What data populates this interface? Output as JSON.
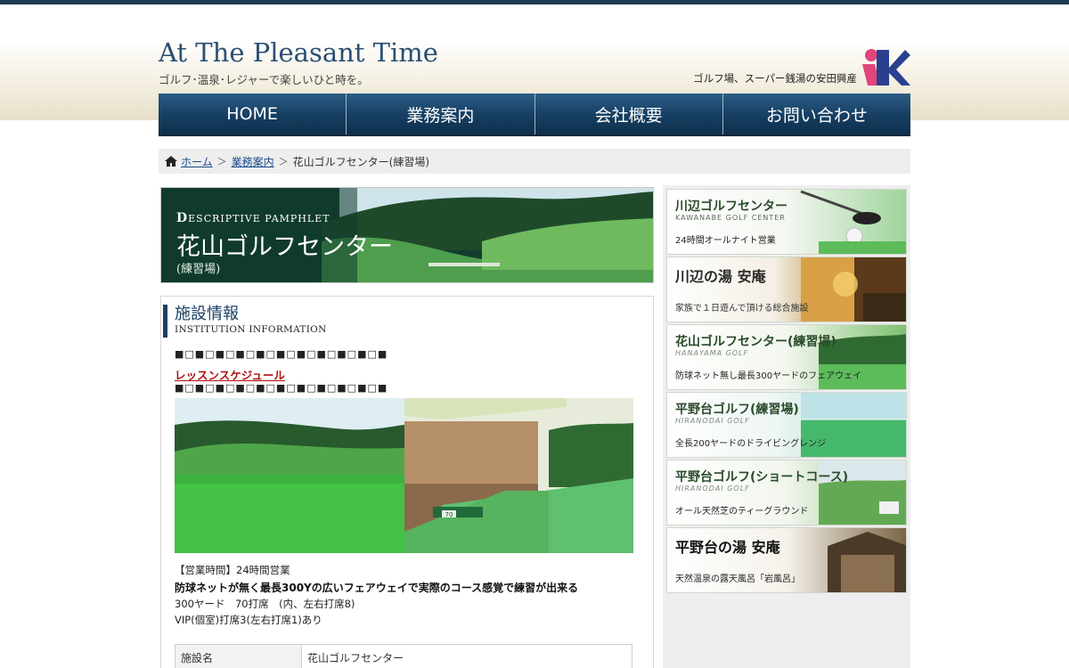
{
  "header": {
    "title": "At The Pleasant Time",
    "tagline": "ゴルフ･温泉･レジャーで楽しいひと時を。",
    "company": "ゴルフ場、スーパー銭湯の安田興産",
    "logo_text": "YK"
  },
  "nav": [
    {
      "label": "HOME"
    },
    {
      "label": "業務案内"
    },
    {
      "label": "会社概要"
    },
    {
      "label": "お問い合わせ"
    }
  ],
  "breadcrumb": {
    "home": "ホーム",
    "sep": "＞",
    "parent": "業務案内",
    "current": "花山ゴルフセンター(練習場)"
  },
  "hero": {
    "pamphlet_initial": "D",
    "pamphlet_rest": "ESCRIPTIVE PAMPHLET",
    "title": "花山ゴルフセンター",
    "subtitle": "(練習場)"
  },
  "info": {
    "title": "施設情報",
    "title_en": "INSTITUTION INFORMATION",
    "squares": "■□■□■□■□■□■□■□■□■□■□■",
    "lesson_link": "レッスンスケジュール",
    "hours": "【営業時間】24時間営業",
    "headline": "防球ネットが無く最長300Yの広いフェアウェイで実際のコース感覚で練習が出来る",
    "detail1": "300ヤード　70打席　(内、左右打席8)",
    "detail2": "VIP(個室)打席3(左右打席1)あり",
    "bay_number": "70",
    "table": [
      {
        "label": "施設名",
        "value": "花山ゴルフセンター"
      }
    ]
  },
  "sidebar": [
    {
      "title": "川辺ゴルフセンター",
      "en": "KAWANABE GOLF CENTER",
      "desc": "24時間オールナイト営業",
      "theme": "light",
      "title_color": "#2b4b2b"
    },
    {
      "title": "川辺の湯 安庵",
      "en": "",
      "desc": "家族で１日遊んで頂ける総合施設",
      "theme": "dark",
      "title_color": "#ffffff"
    },
    {
      "title": "花山ゴルフセンター(練習場)",
      "en": "HANAYAMA GOLF",
      "desc": "防球ネット無し最長300ヤードのフェアウェイ",
      "theme": "light",
      "title_color": "#2b4b2b"
    },
    {
      "title": "平野台ゴルフ(練習場)",
      "en": "HIRANODAI GOLF",
      "desc": "全長200ヤードのドライビングレンジ",
      "theme": "light",
      "title_color": "#2b4b2b"
    },
    {
      "title": "平野台ゴルフ(ショートコース)",
      "en": "HIRANODAI GOLF",
      "desc": "オール天然芝のティーグラウンド",
      "theme": "light",
      "title_color": "#2b4b2b"
    },
    {
      "title": "平野台の湯 安庵",
      "en": "",
      "desc": "天然温泉の露天風呂「岩風呂」",
      "theme": "light",
      "title_color": "#111111"
    }
  ]
}
